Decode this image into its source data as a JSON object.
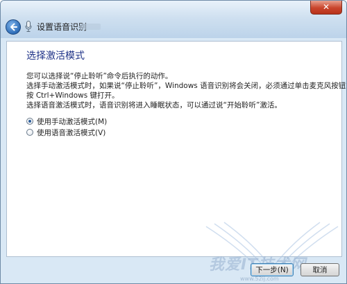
{
  "window": {
    "title": "设置语音识别",
    "close_label": "✕"
  },
  "page": {
    "heading": "选择激活模式",
    "paragraphs": [
      "您可以选择说“停止聆听”命令后执行的动作。",
      "选择手动激活模式时，如果说“停止聆听”，Windows 语音识别将会关闭，必须通过单击麦克风按钮或",
      "按 Ctrl+Windows 键打开。",
      "选择语音激活模式时，语音识别将进入睡眠状态，可以通过说“开始聆听”激活。"
    ],
    "options": [
      {
        "label": "使用手动激活模式(M)",
        "checked": true
      },
      {
        "label": "使用语音激活模式(V)",
        "checked": false
      }
    ]
  },
  "footer": {
    "next_label": "下一步(N)",
    "cancel_label": "取消"
  },
  "watermark": {
    "text": "我爱IT技术网",
    "url": "www.52ij.com"
  },
  "colors": {
    "heading": "#1e3287",
    "frame": "#d9e8f5",
    "close": "#c9452c"
  },
  "icons": [
    "back-arrow-icon",
    "microphone-icon",
    "close-icon"
  ]
}
